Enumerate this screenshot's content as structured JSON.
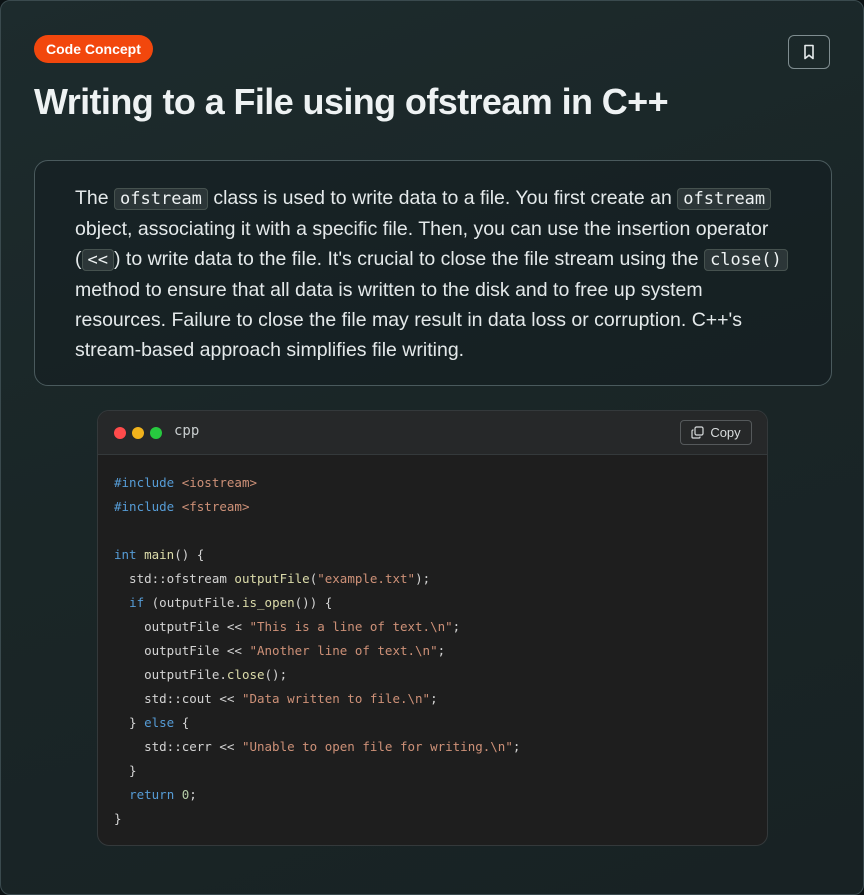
{
  "badge": {
    "label": "Code Concept"
  },
  "icons": {
    "bookmark": "bookmark-icon",
    "copy": "copy-icon"
  },
  "title": "Writing to a File using ofstream in C++",
  "description": {
    "t1": "The ",
    "c1": "ofstream",
    "t2": " class is used to write data to a file. You first create an ",
    "c2": "ofstream",
    "t3": " object, associating it with a specific file. Then, you can use the insertion operator (",
    "c3": "<<",
    "t4": ") to write data to the file. It's crucial to close the file stream using the ",
    "c4": "close()",
    "t5": " method to ensure that all data is written to the disk and to free up system resources. Failure to close the file may result in data loss or corruption. C++'s stream-based approach simplifies file writing."
  },
  "code": {
    "language": "cpp",
    "copy_label": "Copy",
    "window_dots": {
      "red": "#ff4b4b",
      "yellow": "#f0b21c",
      "green": "#27c93f"
    },
    "lines": [
      [
        {
          "t": "#include ",
          "c": "kw"
        },
        {
          "t": "<iostream>",
          "c": "inc"
        }
      ],
      [
        {
          "t": "#include ",
          "c": "kw"
        },
        {
          "t": "<fstream>",
          "c": "inc"
        }
      ],
      [],
      [
        {
          "t": "int ",
          "c": "kw"
        },
        {
          "t": "main",
          "c": "fn"
        },
        {
          "t": "() {",
          "c": "plain"
        }
      ],
      [
        {
          "t": "  std::ofstream ",
          "c": "plain"
        },
        {
          "t": "outputFile",
          "c": "fn"
        },
        {
          "t": "(",
          "c": "plain"
        },
        {
          "t": "\"example.txt\"",
          "c": "str"
        },
        {
          "t": ");",
          "c": "plain"
        }
      ],
      [
        {
          "t": "  ",
          "c": "plain"
        },
        {
          "t": "if",
          "c": "kw"
        },
        {
          "t": " (outputFile.",
          "c": "plain"
        },
        {
          "t": "is_open",
          "c": "fn"
        },
        {
          "t": "()) {",
          "c": "plain"
        }
      ],
      [
        {
          "t": "    outputFile << ",
          "c": "plain"
        },
        {
          "t": "\"This is a line of text.\\n\"",
          "c": "str"
        },
        {
          "t": ";",
          "c": "plain"
        }
      ],
      [
        {
          "t": "    outputFile << ",
          "c": "plain"
        },
        {
          "t": "\"Another line of text.\\n\"",
          "c": "str"
        },
        {
          "t": ";",
          "c": "plain"
        }
      ],
      [
        {
          "t": "    outputFile.",
          "c": "plain"
        },
        {
          "t": "close",
          "c": "fn"
        },
        {
          "t": "();",
          "c": "plain"
        }
      ],
      [
        {
          "t": "    std::cout << ",
          "c": "plain"
        },
        {
          "t": "\"Data written to file.\\n\"",
          "c": "str"
        },
        {
          "t": ";",
          "c": "plain"
        }
      ],
      [
        {
          "t": "  } ",
          "c": "plain"
        },
        {
          "t": "else",
          "c": "kw"
        },
        {
          "t": " {",
          "c": "plain"
        }
      ],
      [
        {
          "t": "    std::cerr << ",
          "c": "plain"
        },
        {
          "t": "\"Unable to open file for writing.\\n\"",
          "c": "str"
        },
        {
          "t": ";",
          "c": "plain"
        }
      ],
      [
        {
          "t": "  }",
          "c": "plain"
        }
      ],
      [
        {
          "t": "  ",
          "c": "plain"
        },
        {
          "t": "return",
          "c": "kw"
        },
        {
          "t": " ",
          "c": "plain"
        },
        {
          "t": "0",
          "c": "num"
        },
        {
          "t": ";",
          "c": "plain"
        }
      ],
      [
        {
          "t": "}",
          "c": "plain"
        }
      ]
    ]
  }
}
